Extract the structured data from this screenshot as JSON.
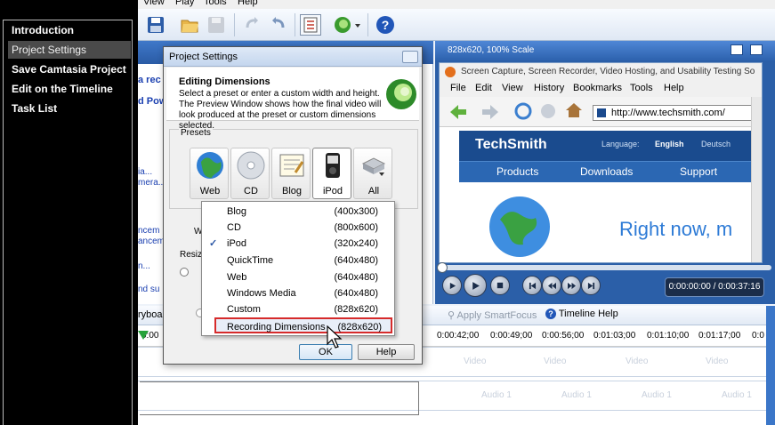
{
  "steps": [
    {
      "label": "Introduction",
      "active": false
    },
    {
      "label": "Project Settings",
      "active": true
    },
    {
      "label": "Save Camtasia Project",
      "active": false
    },
    {
      "label": "Edit on the Timeline",
      "active": false
    },
    {
      "label": "Task List",
      "active": false
    }
  ],
  "menu": {
    "view": "View",
    "play": "Play",
    "tools": "Tools",
    "help": "Help"
  },
  "clipbin": {
    "lines": [
      "a rec",
      "d Pow",
      "ia...",
      "mera...",
      "ncem",
      "ancem",
      "n...",
      "nd su"
    ],
    "storyboard": "ryboar",
    "resize_label": "Resiz",
    "w_label": "W"
  },
  "preview": {
    "header": "828x620, 100% Scale",
    "browser_title": "Screen Capture, Screen Recorder, Video Hosting, and Usability Testing So",
    "browser_menu": [
      "File",
      "Edit",
      "View",
      "History",
      "Bookmarks",
      "Tools",
      "Help"
    ],
    "url": "http://www.techsmith.com/",
    "site_logo": "TechSmith",
    "language_label": "Language:",
    "lang_english": "English",
    "lang_deutsch": "Deutsch",
    "nav": [
      "Products",
      "Downloads",
      "Support"
    ],
    "headline": "Right now, m",
    "timecode": "0:00:00:00 / 0:00:37:16"
  },
  "timeline": {
    "apply_smartfocus": "Apply SmartFocus",
    "timeline_help": "Timeline Help",
    "ticks": [
      "0:00",
      "0:00:42;00",
      "0:00:49;00",
      "0:00:56;00",
      "0:01:03;00",
      "0:01:10;00",
      "0:01:17;00",
      "0:0"
    ],
    "video_label": "Video",
    "audio_label": "Audio 1"
  },
  "dialog": {
    "title": "Project Settings",
    "heading": "Editing Dimensions",
    "description": "Select a preset or enter a custom width and height. The Preview Window shows how the final video will look produced at the preset or custom dimensions selected.",
    "presets_label": "Presets",
    "presets": [
      {
        "label": "Web",
        "icon": "globe-icon",
        "selected": false
      },
      {
        "label": "CD",
        "icon": "cd-icon",
        "selected": false
      },
      {
        "label": "Blog",
        "icon": "blog-icon",
        "selected": false
      },
      {
        "label": "iPod",
        "icon": "ipod-icon",
        "selected": true
      },
      {
        "label": "All",
        "icon": "all-presets-icon",
        "selected": false
      }
    ],
    "ok": "OK",
    "help": "Help"
  },
  "dropdown": {
    "items": [
      {
        "name": "Blog",
        "dim": "(400x300)",
        "checked": false,
        "highlight": false
      },
      {
        "name": "CD",
        "dim": "(800x600)",
        "checked": false,
        "highlight": false
      },
      {
        "name": "iPod",
        "dim": "(320x240)",
        "checked": true,
        "highlight": false
      },
      {
        "name": "QuickTime",
        "dim": "(640x480)",
        "checked": false,
        "highlight": false
      },
      {
        "name": "Web",
        "dim": "(640x480)",
        "checked": false,
        "highlight": false
      },
      {
        "name": "Windows Media",
        "dim": "(640x480)",
        "checked": false,
        "highlight": false
      },
      {
        "name": "Custom",
        "dim": "(828x620)",
        "checked": false,
        "highlight": false
      },
      {
        "name": "Recording Dimensions",
        "dim": "(828x620)",
        "checked": false,
        "highlight": true
      }
    ]
  }
}
